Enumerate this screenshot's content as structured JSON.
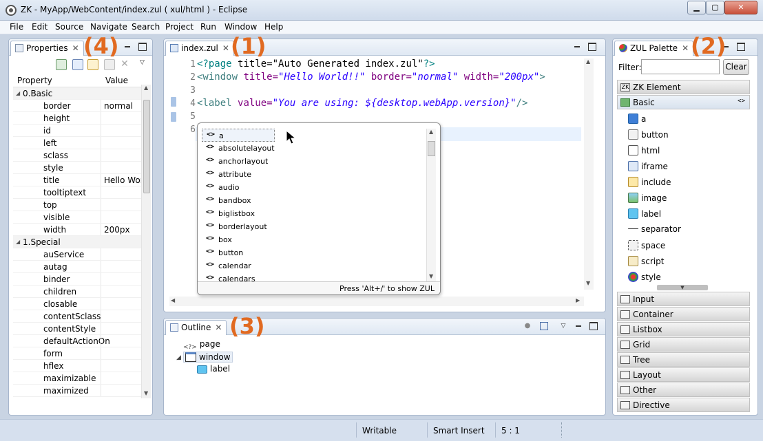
{
  "window": {
    "title": "ZK - MyApp/WebContent/index.zul ( xul/html ) - Eclipse",
    "minimize": "0",
    "maximize": "1",
    "close": "r"
  },
  "menu": [
    "File",
    "Edit",
    "Source",
    "Navigate",
    "Search",
    "Project",
    "Run",
    "Window",
    "Help"
  ],
  "callouts": {
    "editor": "(1)",
    "palette": "(2)",
    "outline": "(3)",
    "properties": "(4)"
  },
  "properties": {
    "tab_label": "Properties",
    "columns": {
      "property": "Property",
      "value": "Value"
    },
    "rows": [
      {
        "name": "0.Basic",
        "value": "",
        "group": true
      },
      {
        "name": "border",
        "value": "normal"
      },
      {
        "name": "height",
        "value": ""
      },
      {
        "name": "id",
        "value": ""
      },
      {
        "name": "left",
        "value": ""
      },
      {
        "name": "sclass",
        "value": ""
      },
      {
        "name": "style",
        "value": ""
      },
      {
        "name": "title",
        "value": "Hello Wor"
      },
      {
        "name": "tooltiptext",
        "value": ""
      },
      {
        "name": "top",
        "value": ""
      },
      {
        "name": "visible",
        "value": ""
      },
      {
        "name": "width",
        "value": "200px"
      },
      {
        "name": "1.Special",
        "value": "",
        "group": true
      },
      {
        "name": "auService",
        "value": ""
      },
      {
        "name": "autag",
        "value": ""
      },
      {
        "name": "binder",
        "value": ""
      },
      {
        "name": "children",
        "value": ""
      },
      {
        "name": "closable",
        "value": ""
      },
      {
        "name": "contentSclass",
        "value": ""
      },
      {
        "name": "contentStyle",
        "value": ""
      },
      {
        "name": "defaultActionOn",
        "value": ""
      },
      {
        "name": "form",
        "value": ""
      },
      {
        "name": "hflex",
        "value": ""
      },
      {
        "name": "maximizable",
        "value": ""
      },
      {
        "name": "maximized",
        "value": ""
      }
    ]
  },
  "editor": {
    "tab_label": "index.zul",
    "line_numbers": [
      "1",
      "2",
      "3",
      "4",
      "5",
      "6"
    ],
    "code": {
      "l1_a": "<?page ",
      "l1_b": "title=\"Auto Generated index.zul\"",
      "l1_c": "?>",
      "l2_a": "<window ",
      "l2_b": "title=",
      "l2_c": "\"Hello World!!\"",
      "l2_d": " border=",
      "l2_e": "\"normal\"",
      "l2_f": " width=",
      "l2_g": "\"200px\"",
      "l2_h": ">",
      "l4_a": "<label ",
      "l4_b": "value=",
      "l4_c": "\"You are using: ${desktop.webApp.version}\"",
      "l4_d": "/>"
    },
    "autocomplete": {
      "items": [
        "a",
        "absolutelayout",
        "anchorlayout",
        "attribute",
        "audio",
        "bandbox",
        "biglistbox",
        "borderlayout",
        "box",
        "button",
        "calendar",
        "calendars"
      ],
      "item_icon": "<>",
      "footer": "Press 'Alt+/' to show ZUL"
    }
  },
  "outline": {
    "tab_label": "Outline",
    "nodes": [
      "page",
      "window",
      "label"
    ],
    "page_icon": "<?>"
  },
  "palette": {
    "tab_label": "ZUL Palette",
    "filter_label": "Filter:",
    "filter_value": "",
    "clear_button": "Clear",
    "top_group": "ZK Element",
    "basic_group": "Basic",
    "basic_items": [
      "a",
      "button",
      "html",
      "iframe",
      "include",
      "image",
      "label",
      "separator",
      "space",
      "script",
      "style"
    ],
    "groups": [
      "Input",
      "Container",
      "Listbox",
      "Grid",
      "Tree",
      "Layout",
      "Other",
      "Directive"
    ]
  },
  "status": {
    "writable": "Writable",
    "insert_mode": "Smart Insert",
    "position": "5 : 1"
  },
  "colors": {
    "callout": "#e16a21",
    "tag": "#3f7f7f",
    "attribute": "#7f007f",
    "string": "#2a00ff"
  }
}
